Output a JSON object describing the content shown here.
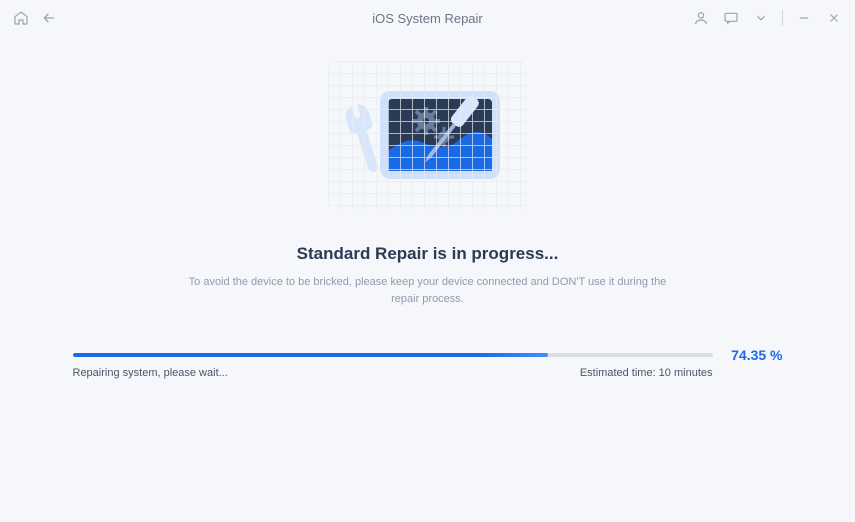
{
  "titlebar": {
    "title": "iOS System Repair"
  },
  "main": {
    "heading": "Standard Repair is in progress...",
    "subtext": "To avoid the device to be bricked, please keep your device connected and DON'T use it during the repair process."
  },
  "progress": {
    "percent_text": "74.35 %",
    "percent_value": 74.35,
    "status_text": "Repairing system, please wait...",
    "estimated_time": "Estimated time: 10 minutes"
  },
  "colors": {
    "accent": "#1a6ae6",
    "text_dark": "#2b3a55",
    "text_muted": "#8f9bb0"
  }
}
